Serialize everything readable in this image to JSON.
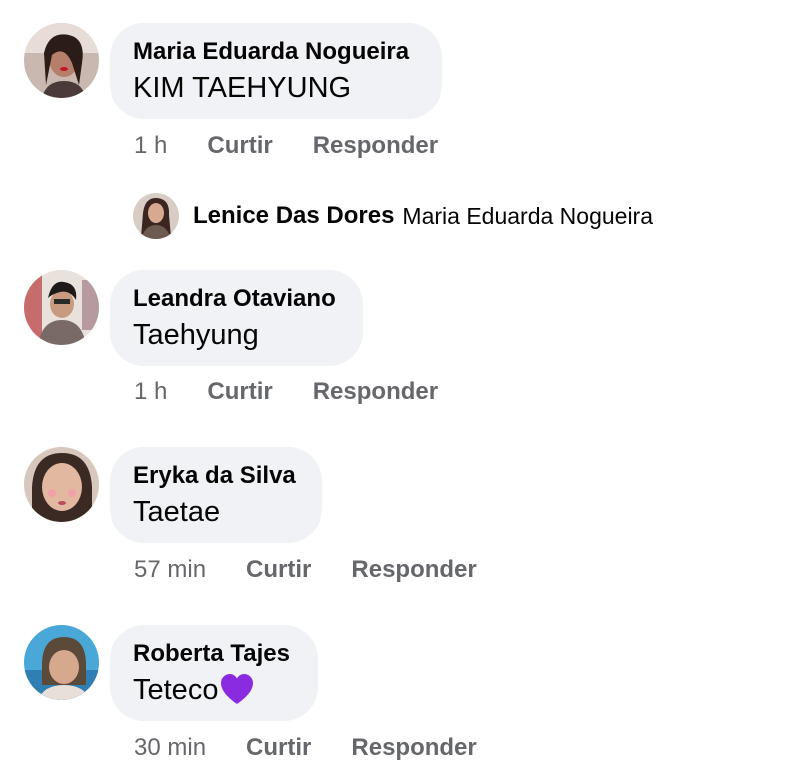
{
  "comments": [
    {
      "author": "Maria Eduarda Nogueira",
      "text": "KIM TAEHYUNG",
      "time": "1 h",
      "like_label": "Curtir",
      "reply_label": "Responder",
      "avatar_icon": "profile-photo"
    },
    {
      "author": "Leandra Otaviano",
      "text": "Taehyung",
      "time": "1 h",
      "like_label": "Curtir",
      "reply_label": "Responder",
      "avatar_icon": "profile-photo"
    },
    {
      "author": "Eryka da Silva",
      "text": "Taetae",
      "time": "57 min",
      "like_label": "Curtir",
      "reply_label": "Responder",
      "avatar_icon": "profile-photo"
    },
    {
      "author": "Roberta Tajes",
      "text": "Teteco",
      "time": "30 min",
      "like_label": "Curtir",
      "reply_label": "Responder",
      "avatar_icon": "profile-photo",
      "emoji": "purple-heart"
    }
  ],
  "reply": {
    "author": "Lenice Das Dores",
    "target": "Maria Eduarda Nogueira",
    "avatar_icon": "profile-photo"
  },
  "colors": {
    "bubble": "#f0f2f5",
    "text": "#050505",
    "secondary": "#65676b",
    "heart": "#8a2be2"
  }
}
